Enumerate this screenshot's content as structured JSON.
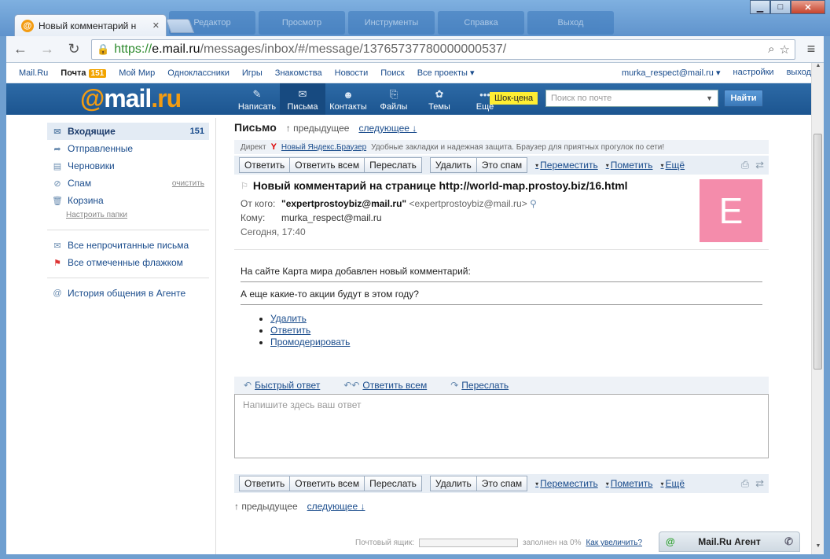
{
  "browser": {
    "tab_title": "Новый комментарий н",
    "url_proto": "https://",
    "url_host": "e.mail.ru",
    "url_path": "/messages/inbox/#/message/13765737780000000537/",
    "bg_tabs": [
      "Редактор",
      "Просмотр",
      "Инструменты",
      "Справка",
      "Выход"
    ]
  },
  "portal": {
    "links": [
      "Mail.Ru",
      "Почта",
      "Мой Мир",
      "Одноклассники",
      "Игры",
      "Знакомства",
      "Новости",
      "Поиск",
      "Все проекты ▾"
    ],
    "mail_count": "151",
    "user": "murka_respect@mail.ru ▾",
    "settings": "настройки",
    "logout": "выход"
  },
  "header": {
    "logo_at": "@",
    "logo_name": "mail",
    "logo_tld": ".ru",
    "nav": [
      {
        "label": "Написать",
        "icon": "✎"
      },
      {
        "label": "Письма",
        "icon": "✉"
      },
      {
        "label": "Контакты",
        "icon": "☻"
      },
      {
        "label": "Файлы",
        "icon": "⎘"
      },
      {
        "label": "Темы",
        "icon": "✿"
      },
      {
        "label": "Ещё",
        "icon": "•••"
      }
    ],
    "promo": "Шок-цена",
    "search_placeholder": "Поиск по почте",
    "search_button": "Найти"
  },
  "sidebar": {
    "items": [
      {
        "label": "Входящие",
        "count": "151"
      },
      {
        "label": "Отправленные"
      },
      {
        "label": "Черновики"
      },
      {
        "label": "Спам",
        "action": "очистить"
      },
      {
        "label": "Корзина"
      }
    ],
    "settings_link": "Настроить папки",
    "unread": "Все непрочитанные письма",
    "flagged": "Все отмеченные флажком",
    "agent_history": "История общения в Агенте"
  },
  "message": {
    "section_title": "Письмо",
    "prev": "↑ предыдущее",
    "next": "следующее ↓",
    "direct_label": "Директ",
    "direct_link": "Новый Яндекс.Браузер",
    "direct_text": "Удобные закладки и надежная защита. Браузер для приятных прогулок по сети!",
    "actions": {
      "reply": "Ответить",
      "reply_all": "Ответить всем",
      "forward": "Переслать",
      "delete": "Удалить",
      "spam": "Это спам",
      "move": "Переместить",
      "mark": "Пометить",
      "more": "Ещё"
    },
    "subject": "Новый комментарий на странице http://world-map.prostoy.biz/16.html",
    "from_label": "От кого:",
    "from_name": "\"expertprostoybiz@mail.ru\"",
    "from_email": "<expertprostoybiz@mail.ru>",
    "to_label": "Кому:",
    "to": "murka_respect@mail.ru",
    "date": "Сегодня, 17:40",
    "avatar_letter": "E",
    "avatar_color": "#f48cab",
    "body_line1": "На сайте Карта мира добавлен новый комментарий:",
    "body_line2": "А еще какие-то акции будут в этом году?",
    "body_links": [
      "Удалить",
      "Ответить",
      "Промодерировать"
    ]
  },
  "reply": {
    "quick": "Быстрый ответ",
    "all": "Ответить всем",
    "forward": "Переслать",
    "placeholder": "Напишите здесь ваш ответ"
  },
  "quota": {
    "label": "Почтовый ящик:",
    "filled": "заполнен на 0%",
    "link": "Как увеличить?",
    "fraction": 0
  },
  "agent": {
    "title": "Mail.Ru Агент"
  }
}
